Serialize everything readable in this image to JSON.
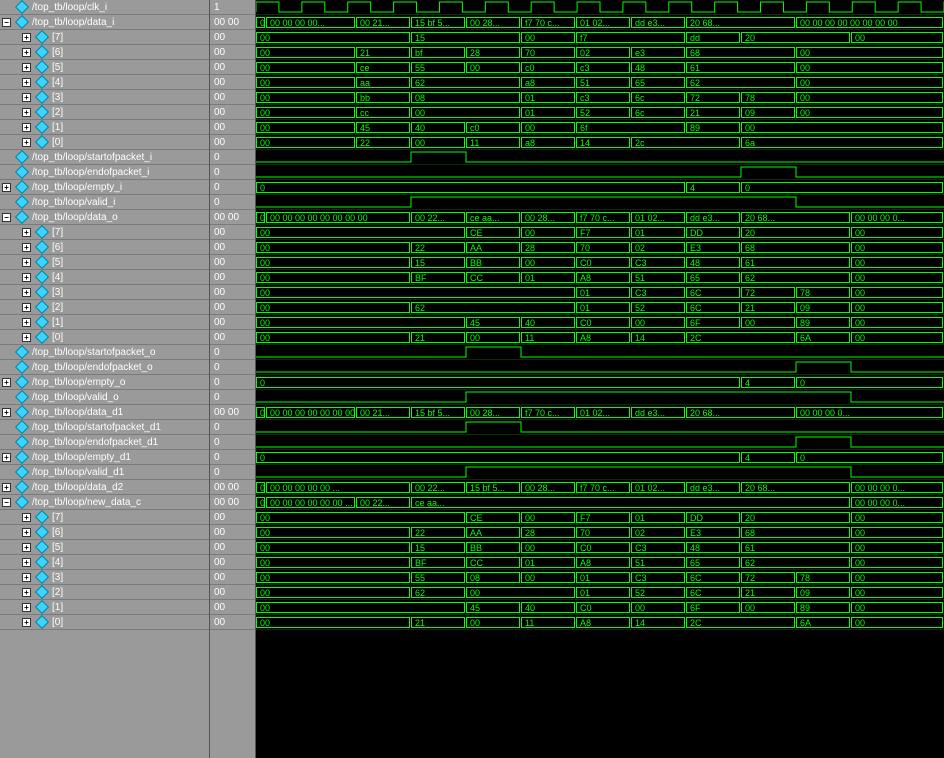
{
  "edges": [
    0,
    45,
    90,
    135,
    180,
    225,
    270,
    315,
    360,
    405,
    450,
    495,
    540,
    585,
    630,
    676
  ],
  "signals": [
    {
      "name": "/top_tb/loop/clk_i",
      "val": "1",
      "type": "clock",
      "depth": 0,
      "exp": ""
    },
    {
      "name": "/top_tb/loop/data_i",
      "val": "00 00",
      "type": "bus",
      "depth": 0,
      "exp": "-",
      "segs": [
        "00 00",
        "00 00 00 00...",
        "00 21...",
        "15 bf 5...",
        "00 28...",
        "f7 70 c...",
        "01 02...",
        "dd e3...",
        "20 68...",
        "",
        "00 00 00 00 00 00 00 00"
      ]
    },
    {
      "name": "[7]",
      "val": "00",
      "type": "bus",
      "depth": 1,
      "exp": "+",
      "segs": [
        "00",
        "",
        "",
        "15",
        "",
        "00",
        "f7",
        "",
        "dd",
        "20",
        "",
        "00"
      ]
    },
    {
      "name": "[6]",
      "val": "00",
      "type": "bus",
      "depth": 1,
      "exp": "+",
      "segs": [
        "00",
        "",
        "21",
        "bf",
        "28",
        "70",
        "02",
        "e3",
        "68",
        "",
        "00"
      ]
    },
    {
      "name": "[5]",
      "val": "00",
      "type": "bus",
      "depth": 1,
      "exp": "+",
      "segs": [
        "00",
        "",
        "ce",
        "55",
        "00",
        "c0",
        "c3",
        "48",
        "61",
        "",
        "00"
      ]
    },
    {
      "name": "[4]",
      "val": "00",
      "type": "bus",
      "depth": 1,
      "exp": "+",
      "segs": [
        "00",
        "",
        "aa",
        "62",
        "",
        "a8",
        "51",
        "65",
        "62",
        "",
        "00"
      ]
    },
    {
      "name": "[3]",
      "val": "00",
      "type": "bus",
      "depth": 1,
      "exp": "+",
      "segs": [
        "00",
        "",
        "bb",
        "08",
        "",
        "01",
        "c3",
        "6c",
        "72",
        "78",
        "00"
      ]
    },
    {
      "name": "[2]",
      "val": "00",
      "type": "bus",
      "depth": 1,
      "exp": "+",
      "segs": [
        "00",
        "",
        "cc",
        "00",
        "",
        "01",
        "52",
        "6c",
        "21",
        "09",
        "00"
      ]
    },
    {
      "name": "[1]",
      "val": "00",
      "type": "bus",
      "depth": 1,
      "exp": "+",
      "segs": [
        "00",
        "",
        "45",
        "40",
        "c0",
        "00",
        "6f",
        "",
        "89",
        "00"
      ]
    },
    {
      "name": "[0]",
      "val": "00",
      "type": "bus",
      "depth": 1,
      "exp": "+",
      "segs": [
        "00",
        "",
        "22",
        "00",
        "11",
        "a8",
        "14",
        "2c",
        "",
        "6a",
        ""
      ]
    },
    {
      "name": "/top_tb/loop/startofpacket_i",
      "val": "0",
      "type": "pulse",
      "depth": 0,
      "exp": "",
      "high": [
        2,
        3
      ]
    },
    {
      "name": "/top_tb/loop/endofpacket_i",
      "val": "0",
      "type": "pulse",
      "depth": 0,
      "exp": "",
      "high": [
        8,
        9
      ]
    },
    {
      "name": "/top_tb/loop/empty_i",
      "val": "0",
      "type": "bus",
      "depth": 0,
      "exp": "+",
      "segs": [
        "0",
        "",
        "",
        "",
        "",
        "",
        "",
        "",
        "4",
        "0",
        ""
      ]
    },
    {
      "name": "/top_tb/loop/valid_i",
      "val": "0",
      "type": "pulse",
      "depth": 0,
      "exp": "",
      "high": [
        2,
        9
      ]
    },
    {
      "name": "/top_tb/loop/data_o",
      "val": "00 00",
      "type": "bus",
      "depth": 0,
      "exp": "-",
      "segs": [
        "00 00",
        "00 00 00 00 00 00 00 00",
        "",
        "00 22...",
        "ce aa...",
        "00 28...",
        "f7 70 c...",
        "01 02...",
        "dd e3...",
        "20 68...",
        "",
        "00 00 00 0..."
      ]
    },
    {
      "name": "[7]",
      "val": "00",
      "type": "bus",
      "depth": 1,
      "exp": "+",
      "segs": [
        "00",
        "",
        "",
        "",
        "CE",
        "00",
        "F7",
        "01",
        "DD",
        "20",
        "",
        "00"
      ]
    },
    {
      "name": "[6]",
      "val": "00",
      "type": "bus",
      "depth": 1,
      "exp": "+",
      "segs": [
        "00",
        "",
        "",
        "22",
        "AA",
        "28",
        "70",
        "02",
        "E3",
        "68",
        "",
        "00"
      ]
    },
    {
      "name": "[5]",
      "val": "00",
      "type": "bus",
      "depth": 1,
      "exp": "+",
      "segs": [
        "00",
        "",
        "",
        "15",
        "BB",
        "00",
        "C0",
        "C3",
        "48",
        "61",
        "",
        "00"
      ]
    },
    {
      "name": "[4]",
      "val": "00",
      "type": "bus",
      "depth": 1,
      "exp": "+",
      "segs": [
        "00",
        "",
        "",
        "BF",
        "CC",
        "01",
        "A8",
        "51",
        "65",
        "62",
        "",
        "00"
      ]
    },
    {
      "name": "[3]",
      "val": "00",
      "type": "bus",
      "depth": 1,
      "exp": "+",
      "segs": [
        "00",
        "",
        "",
        "",
        "",
        "",
        "01",
        "C3",
        "6C",
        "72",
        "78",
        "00"
      ]
    },
    {
      "name": "[2]",
      "val": "00",
      "type": "bus",
      "depth": 1,
      "exp": "+",
      "segs": [
        "00",
        "",
        "",
        "62",
        "",
        "",
        "01",
        "52",
        "6C",
        "21",
        "09",
        "00"
      ]
    },
    {
      "name": "[1]",
      "val": "00",
      "type": "bus",
      "depth": 1,
      "exp": "+",
      "segs": [
        "00",
        "",
        "",
        "",
        "45",
        "40",
        "C0",
        "00",
        "6F",
        "00",
        "89",
        "00"
      ]
    },
    {
      "name": "[0]",
      "val": "00",
      "type": "bus",
      "depth": 1,
      "exp": "+",
      "segs": [
        "00",
        "",
        "",
        "21",
        "00",
        "11",
        "A8",
        "14",
        "2C",
        "",
        "6A",
        "00"
      ]
    },
    {
      "name": "/top_tb/loop/startofpacket_o",
      "val": "0",
      "type": "pulse",
      "depth": 0,
      "exp": "",
      "high": [
        3,
        4
      ]
    },
    {
      "name": "/top_tb/loop/endofpacket_o",
      "val": "0",
      "type": "pulse",
      "depth": 0,
      "exp": "",
      "high": [
        9,
        10
      ]
    },
    {
      "name": "/top_tb/loop/empty_o",
      "val": "0",
      "type": "bus",
      "depth": 0,
      "exp": "+",
      "segs": [
        "0",
        "",
        "",
        "",
        "",
        "",
        "",
        "",
        "",
        "4",
        "0",
        ""
      ]
    },
    {
      "name": "/top_tb/loop/valid_o",
      "val": "0",
      "type": "pulse",
      "depth": 0,
      "exp": "",
      "high": [
        3,
        10
      ]
    },
    {
      "name": "/top_tb/loop/data_d1",
      "val": "00 00",
      "type": "bus",
      "depth": 0,
      "exp": "+",
      "segs": [
        "00 00",
        "00 00 00 00 00 00 00 00",
        "00 21...",
        "15 bf 5...",
        "00 28...",
        "f7 70 c...",
        "01 02...",
        "dd e3...",
        "20 68...",
        "",
        "00 00 00 0..."
      ]
    },
    {
      "name": "/top_tb/loop/startofpacket_d1",
      "val": "0",
      "type": "pulse",
      "depth": 0,
      "exp": "",
      "high": [
        3,
        4
      ]
    },
    {
      "name": "/top_tb/loop/endofpacket_d1",
      "val": "0",
      "type": "pulse",
      "depth": 0,
      "exp": "",
      "high": [
        9,
        10
      ]
    },
    {
      "name": "/top_tb/loop/empty_d1",
      "val": "0",
      "type": "bus",
      "depth": 0,
      "exp": "+",
      "segs": [
        "0",
        "",
        "",
        "",
        "",
        "",
        "",
        "",
        "",
        "4",
        "0",
        ""
      ]
    },
    {
      "name": "/top_tb/loop/valid_d1",
      "val": "0",
      "type": "pulse",
      "depth": 0,
      "exp": "",
      "high": [
        3,
        10
      ]
    },
    {
      "name": "/top_tb/loop/data_d2",
      "val": "00 00",
      "type": "bus",
      "depth": 0,
      "exp": "+",
      "segs": [
        "00 00",
        "00 00 00 00 00 ...",
        "",
        "00 22...",
        "15 bf 5...",
        "00 28...",
        "f7 70 c...",
        "01 02...",
        "dd e3...",
        "20 68...",
        "",
        "00 00 00 0..."
      ]
    },
    {
      "name": "/top_tb/loop/new_data_c",
      "val": "00 00",
      "type": "bus",
      "depth": 0,
      "exp": "-",
      "segs": [
        "00 00",
        "00 00 00 00 00 00 ...",
        "00 22...",
        "ce aa...",
        "",
        "",
        "",
        "",
        "",
        "",
        "",
        "00 00 00 0..."
      ]
    },
    {
      "name": "[7]",
      "val": "00",
      "type": "bus",
      "depth": 1,
      "exp": "+",
      "segs": [
        "00",
        "",
        "",
        "",
        "CE",
        "00",
        "F7",
        "01",
        "DD",
        "20",
        "",
        "00"
      ]
    },
    {
      "name": "[6]",
      "val": "00",
      "type": "bus",
      "depth": 1,
      "exp": "+",
      "segs": [
        "00",
        "",
        "",
        "22",
        "AA",
        "28",
        "70",
        "02",
        "E3",
        "68",
        "",
        "00"
      ]
    },
    {
      "name": "[5]",
      "val": "00",
      "type": "bus",
      "depth": 1,
      "exp": "+",
      "segs": [
        "00",
        "",
        "",
        "15",
        "BB",
        "00",
        "C0",
        "C3",
        "48",
        "61",
        "",
        "00"
      ]
    },
    {
      "name": "[4]",
      "val": "00",
      "type": "bus",
      "depth": 1,
      "exp": "+",
      "segs": [
        "00",
        "",
        "",
        "BF",
        "CC",
        "01",
        "A8",
        "51",
        "65",
        "62",
        "",
        "00"
      ]
    },
    {
      "name": "[3]",
      "val": "00",
      "type": "bus",
      "depth": 1,
      "exp": "+",
      "segs": [
        "00",
        "",
        "",
        "55",
        "08",
        "00",
        "01",
        "C3",
        "6C",
        "72",
        "78",
        "00"
      ]
    },
    {
      "name": "[2]",
      "val": "00",
      "type": "bus",
      "depth": 1,
      "exp": "+",
      "segs": [
        "00",
        "",
        "",
        "62",
        "00",
        "",
        "01",
        "52",
        "6C",
        "21",
        "09",
        "00"
      ]
    },
    {
      "name": "[1]",
      "val": "00",
      "type": "bus",
      "depth": 1,
      "exp": "+",
      "segs": [
        "00",
        "",
        "",
        "",
        "45",
        "40",
        "C0",
        "00",
        "6F",
        "00",
        "89",
        "00"
      ]
    },
    {
      "name": "[0]",
      "val": "00",
      "type": "bus",
      "depth": 1,
      "exp": "+",
      "segs": [
        "00",
        "",
        "",
        "21",
        "00",
        "11",
        "A8",
        "14",
        "2C",
        "",
        "6A",
        "00"
      ]
    }
  ]
}
